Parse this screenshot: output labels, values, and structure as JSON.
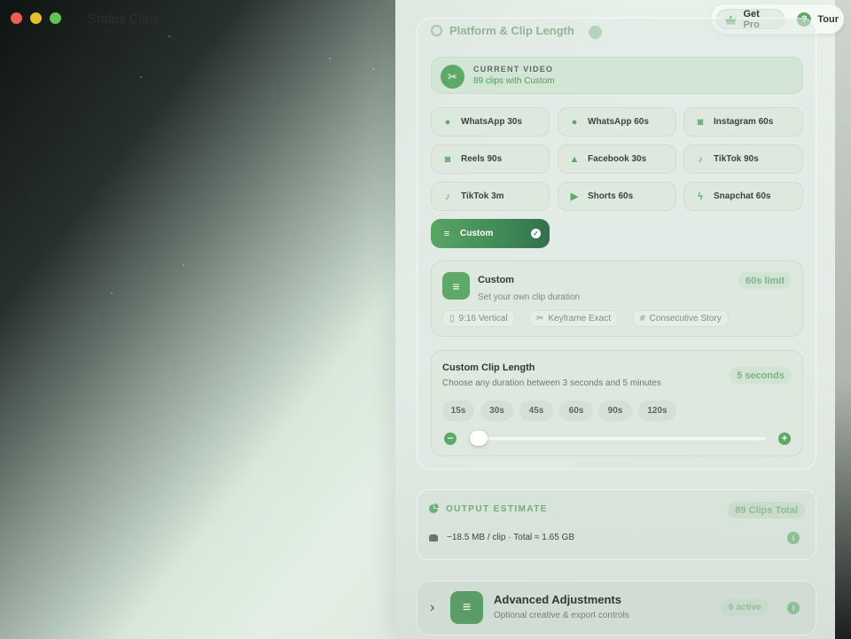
{
  "window": {
    "title": "Status Clips"
  },
  "topbar": {
    "pro_label": "Get Pro",
    "tour_label": "Tour",
    "tour_icon_text": "?"
  },
  "section": {
    "title": "Platform & Clip Length"
  },
  "current_video": {
    "label": "CURRENT VIDEO",
    "value": "89 clips with Custom"
  },
  "platforms": [
    {
      "label": "WhatsApp 30s",
      "icon": "chat-icon"
    },
    {
      "label": "WhatsApp 60s",
      "icon": "chat-icon"
    },
    {
      "label": "Instagram 60s",
      "icon": "camera-icon"
    },
    {
      "label": "Reels 90s",
      "icon": "camera-icon"
    },
    {
      "label": "Facebook 30s",
      "icon": "thumbs-up-icon"
    },
    {
      "label": "TikTok 90s",
      "icon": "music-note-icon"
    },
    {
      "label": "TikTok 3m",
      "icon": "music-note-icon"
    },
    {
      "label": "Shorts 60s",
      "icon": "play-icon"
    },
    {
      "label": "Snapchat 60s",
      "icon": "bolt-icon"
    },
    {
      "label": "Custom",
      "icon": "sliders-icon",
      "active": true
    }
  ],
  "custom_card": {
    "title": "Custom",
    "subtitle": "Set your own clip duration",
    "limit": "60s limit",
    "tags": [
      "9:16 Vertical",
      "Keyframe Exact",
      "Consecutive Story"
    ]
  },
  "clip_length": {
    "title": "Custom Clip Length",
    "subtitle": "Choose any duration between 3 seconds and 5 minutes",
    "value_label": "5 seconds",
    "presets": [
      "15s",
      "30s",
      "45s",
      "60s",
      "90s",
      "120s"
    ],
    "slider_fraction": 0.01,
    "minus": "−",
    "plus": "+"
  },
  "output": {
    "title": "OUTPUT ESTIMATE",
    "total": "89 Clips Total",
    "size_line": "~18.5 MB / clip · Total ≈ 1.65 GB",
    "info": "i"
  },
  "advanced": {
    "title": "Advanced Adjustments",
    "subtitle": "Optional creative & export controls",
    "active": "6 active",
    "info": "i"
  },
  "colors": {
    "accent": "#5fa968",
    "accent_dark": "#346f4e"
  }
}
